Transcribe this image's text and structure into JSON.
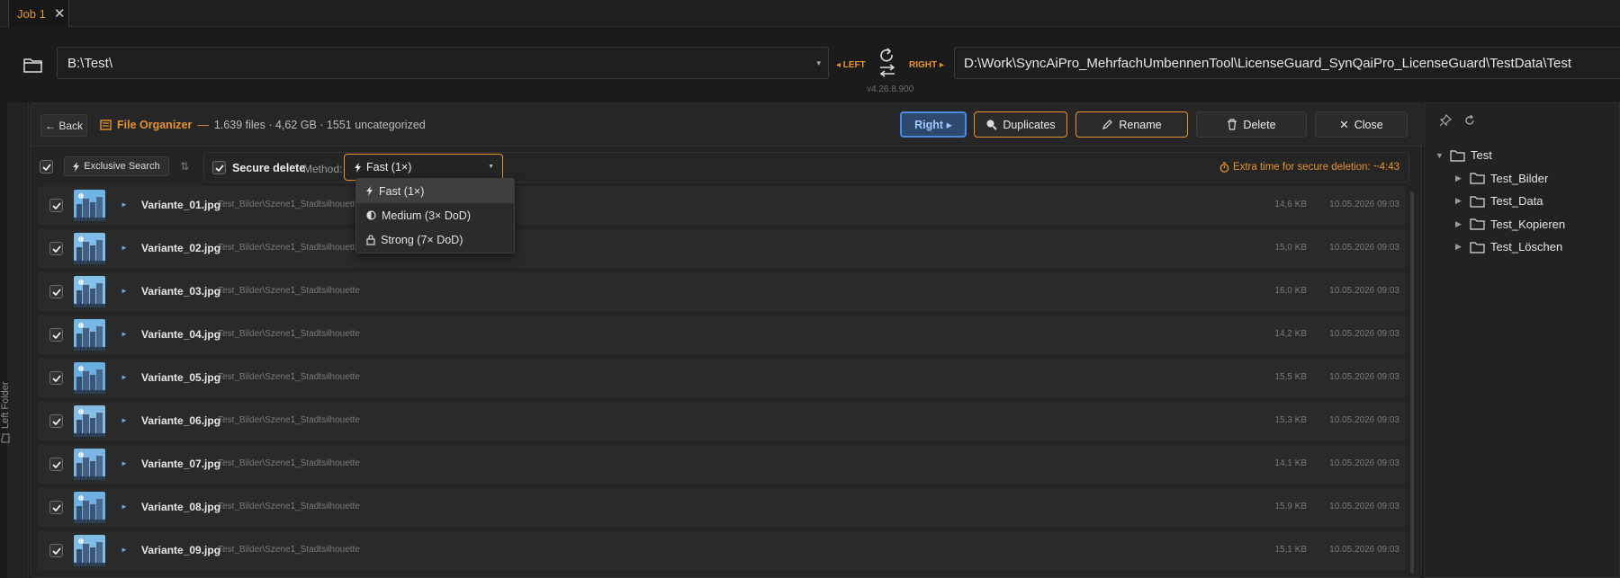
{
  "tabs": [
    {
      "label": "Job 1",
      "close": "✕"
    }
  ],
  "paths": {
    "left": "B:\\Test\\",
    "left_label": "◂ LEFT",
    "right_label": "RIGHT ▸",
    "right": "D:\\Work\\SyncAiPro_MehrfachUmbennenTool\\LicenseGuard_SynQaiPro_LicenseGuard\\TestData\\Test",
    "version": "v4.26.8.900"
  },
  "left_rail": {
    "label": "Left Folder"
  },
  "organizer": {
    "back_label": "← Back",
    "title": "File Organizer",
    "dash": "—",
    "summary": "1.639 files · 4,62 GB · 1551 uncategorized",
    "buttons": {
      "right": "Right ▸",
      "duplicates": "Duplicates",
      "rename": "Rename",
      "delete": "Delete",
      "close": "Close"
    },
    "exclusive_search": "Exclusive Search",
    "secure_delete": "Secure delete",
    "method_label": "Method:",
    "method_value": "Fast (1×)",
    "extra_time": "Extra time for secure deletion: ~4:43",
    "method_options": [
      {
        "label": "Fast (1×)",
        "icon": "bolt-icon"
      },
      {
        "label": "Medium (3× DoD)",
        "icon": "half-circle-icon"
      },
      {
        "label": "Strong (7× DoD)",
        "icon": "lock-icon"
      }
    ]
  },
  "files": [
    {
      "name": "Variante_01.jpg",
      "path": "Test_Bilder\\Szene1_Stadtsilhouette",
      "size": "14,6 KB",
      "date": "10.05.2026 09:03"
    },
    {
      "name": "Variante_02.jpg",
      "path": "Test_Bilder\\Szene1_Stadtsilhouette",
      "size": "15,0 KB",
      "date": "10.05.2026 09:03"
    },
    {
      "name": "Variante_03.jpg",
      "path": "Test_Bilder\\Szene1_Stadtsilhouette",
      "size": "16,0 KB",
      "date": "10.05.2026 09:03"
    },
    {
      "name": "Variante_04.jpg",
      "path": "Test_Bilder\\Szene1_Stadtsilhouette",
      "size": "14,2 KB",
      "date": "10.05.2026 09:03"
    },
    {
      "name": "Variante_05.jpg",
      "path": "Test_Bilder\\Szene1_Stadtsilhouette",
      "size": "15,5 KB",
      "date": "10.05.2026 09:03"
    },
    {
      "name": "Variante_06.jpg",
      "path": "Test_Bilder\\Szene1_Stadtsilhouette",
      "size": "15,3 KB",
      "date": "10.05.2026 09:03"
    },
    {
      "name": "Variante_07.jpg",
      "path": "Test_Bilder\\Szene1_Stadtsilhouette",
      "size": "14,1 KB",
      "date": "10.05.2026 09:03"
    },
    {
      "name": "Variante_08.jpg",
      "path": "Test_Bilder\\Szene1_Stadtsilhouette",
      "size": "15,9 KB",
      "date": "10.05.2026 09:03"
    },
    {
      "name": "Variante_09.jpg",
      "path": "Test_Bilder\\Szene1_Stadtsilhouette",
      "size": "15,1 KB",
      "date": "10.05.2026 09:03"
    }
  ],
  "tree": {
    "root": "Test",
    "children": [
      "Test_Bilder",
      "Test_Data",
      "Test_Kopieren",
      "Test_Löschen"
    ]
  },
  "colors": {
    "accent": "#e6922e",
    "blue": "#4c8ae0"
  }
}
